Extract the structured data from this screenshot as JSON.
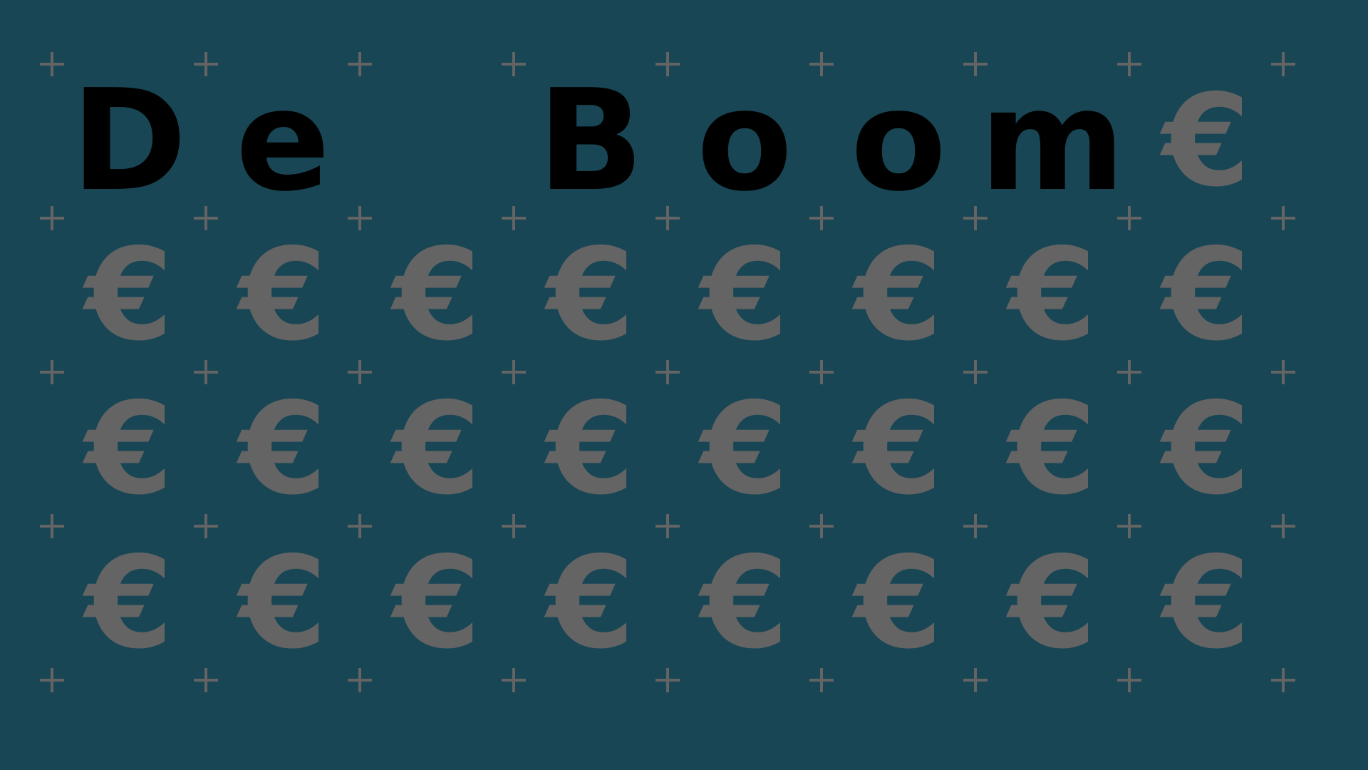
{
  "colors": {
    "background": "#184655",
    "grid_marker": "#646464",
    "symbol": "#646464",
    "letter": "#000000"
  },
  "grid": {
    "columns": 8,
    "rows": 4
  },
  "headline": "De Boom",
  "symbol": "€",
  "rows": [
    [
      "D",
      "e",
      "",
      "B",
      "o",
      "o",
      "m",
      "€"
    ],
    [
      "€",
      "€",
      "€",
      "€",
      "€",
      "€",
      "€",
      "€"
    ],
    [
      "€",
      "€",
      "€",
      "€",
      "€",
      "€",
      "€",
      "€"
    ],
    [
      "€",
      "€",
      "€",
      "€",
      "€",
      "€",
      "€",
      "€"
    ]
  ]
}
